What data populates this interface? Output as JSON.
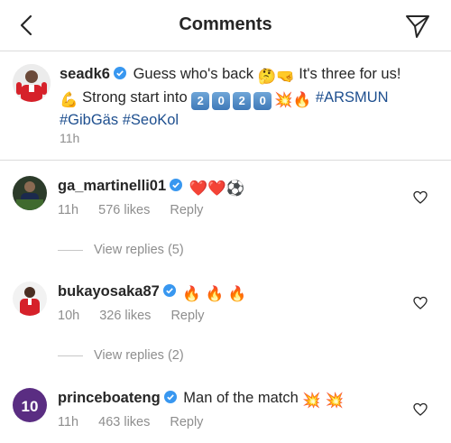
{
  "header": {
    "title": "Comments",
    "back_icon": "chevron-left-icon",
    "direct_icon": "paper-plane-icon"
  },
  "caption": {
    "username": "seadk6",
    "line1_text": "Guess who's back",
    "line1_text_b": "It's three for us!",
    "line2_text": "Strong start into",
    "year_digits": [
      "2",
      "0",
      "2",
      "0"
    ],
    "hashtags": [
      "#ARSMUN",
      "#GibGäs",
      "#SeoKol"
    ],
    "time": "11h"
  },
  "comments": [
    {
      "username": "ga_martinelli01",
      "text": "",
      "emojis": [
        "❤️",
        "❤️",
        "⚽"
      ],
      "time": "11h",
      "likes": "576 likes",
      "reply": "Reply",
      "view_replies": "View replies (5)"
    },
    {
      "username": "bukayosaka87",
      "text": "",
      "emojis": [
        "🔥",
        "🔥",
        "🔥"
      ],
      "time": "10h",
      "likes": "326 likes",
      "reply": "Reply",
      "view_replies": "View replies (2)"
    },
    {
      "username": "princeboateng",
      "text": "Man of the match",
      "emojis": [
        "💥",
        "💥"
      ],
      "time": "11h",
      "likes": "463 likes",
      "reply": "Reply"
    }
  ],
  "colors": {
    "verified": "#3897f0",
    "hashtag": "#1e4f8f",
    "meta": "#8e8e8e",
    "divider": "#dbdbdb"
  }
}
